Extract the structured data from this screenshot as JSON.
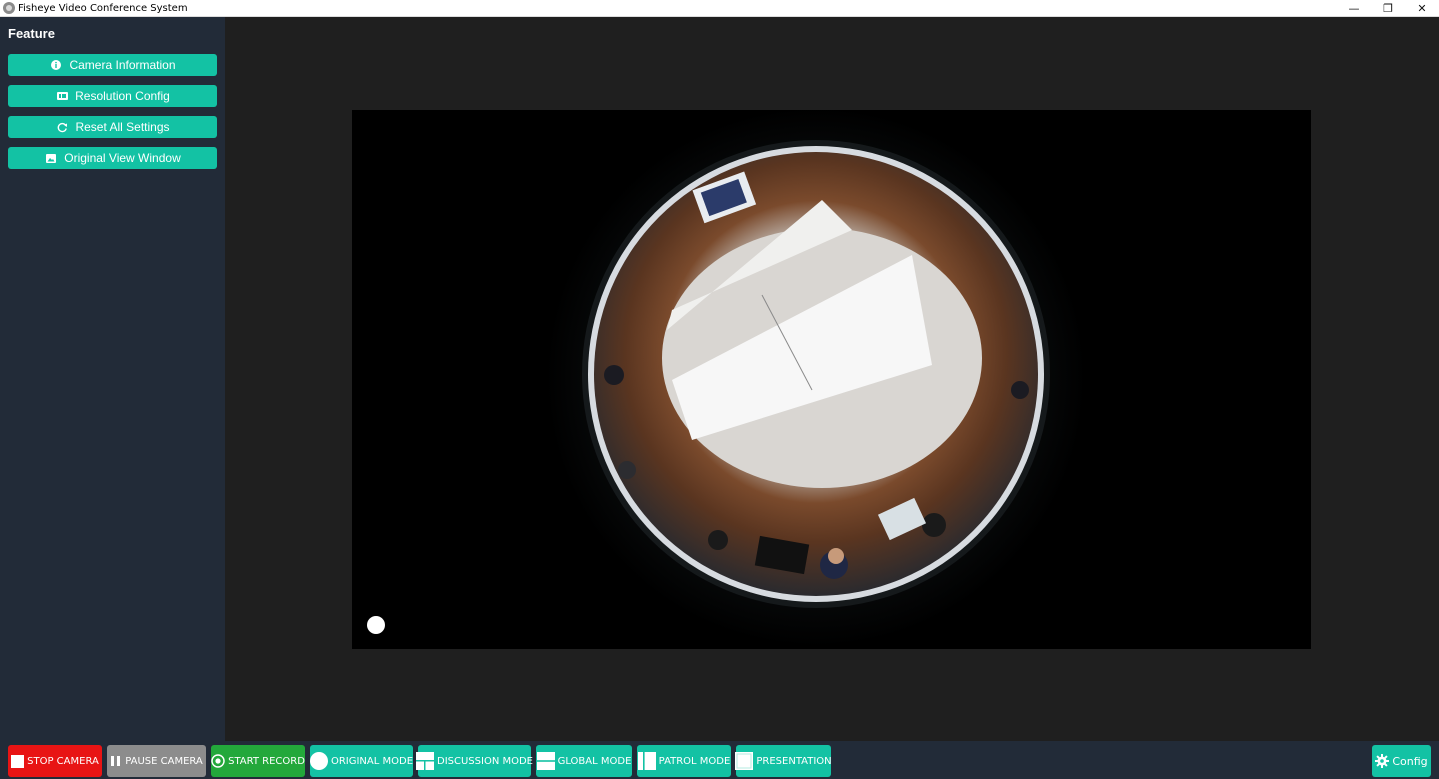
{
  "window": {
    "title": "Fisheye Video Conference System",
    "controls": {
      "minimize": "—",
      "restore": "❐",
      "close": "✕"
    }
  },
  "sidebar": {
    "heading": "Feature",
    "items": [
      {
        "label": "Camera Information",
        "icon": "info-icon"
      },
      {
        "label": "Resolution Config",
        "icon": "resolution-icon"
      },
      {
        "label": "Reset All Settings",
        "icon": "refresh-icon"
      },
      {
        "label": "Original View Window",
        "icon": "image-icon"
      }
    ]
  },
  "toolbar": {
    "stop_camera": "STOP CAMERA",
    "pause_camera": "PAUSE CAMERA",
    "start_record": "START RECORD",
    "original_mode": "ORIGINAL MODE",
    "discussion_mode": "DISCUSSION MODE",
    "global_mode": "GLOBAL MODE",
    "patrol_mode": "PATROL MODE",
    "presentation": "PRESENTATION",
    "config": "Config"
  },
  "colors": {
    "accent": "#13c2a4",
    "stop": "#e81414",
    "pause": "#8c8c8c",
    "record": "#23a83b",
    "sidebar_bg": "#222b38",
    "main_bg": "#1f1f1f"
  }
}
